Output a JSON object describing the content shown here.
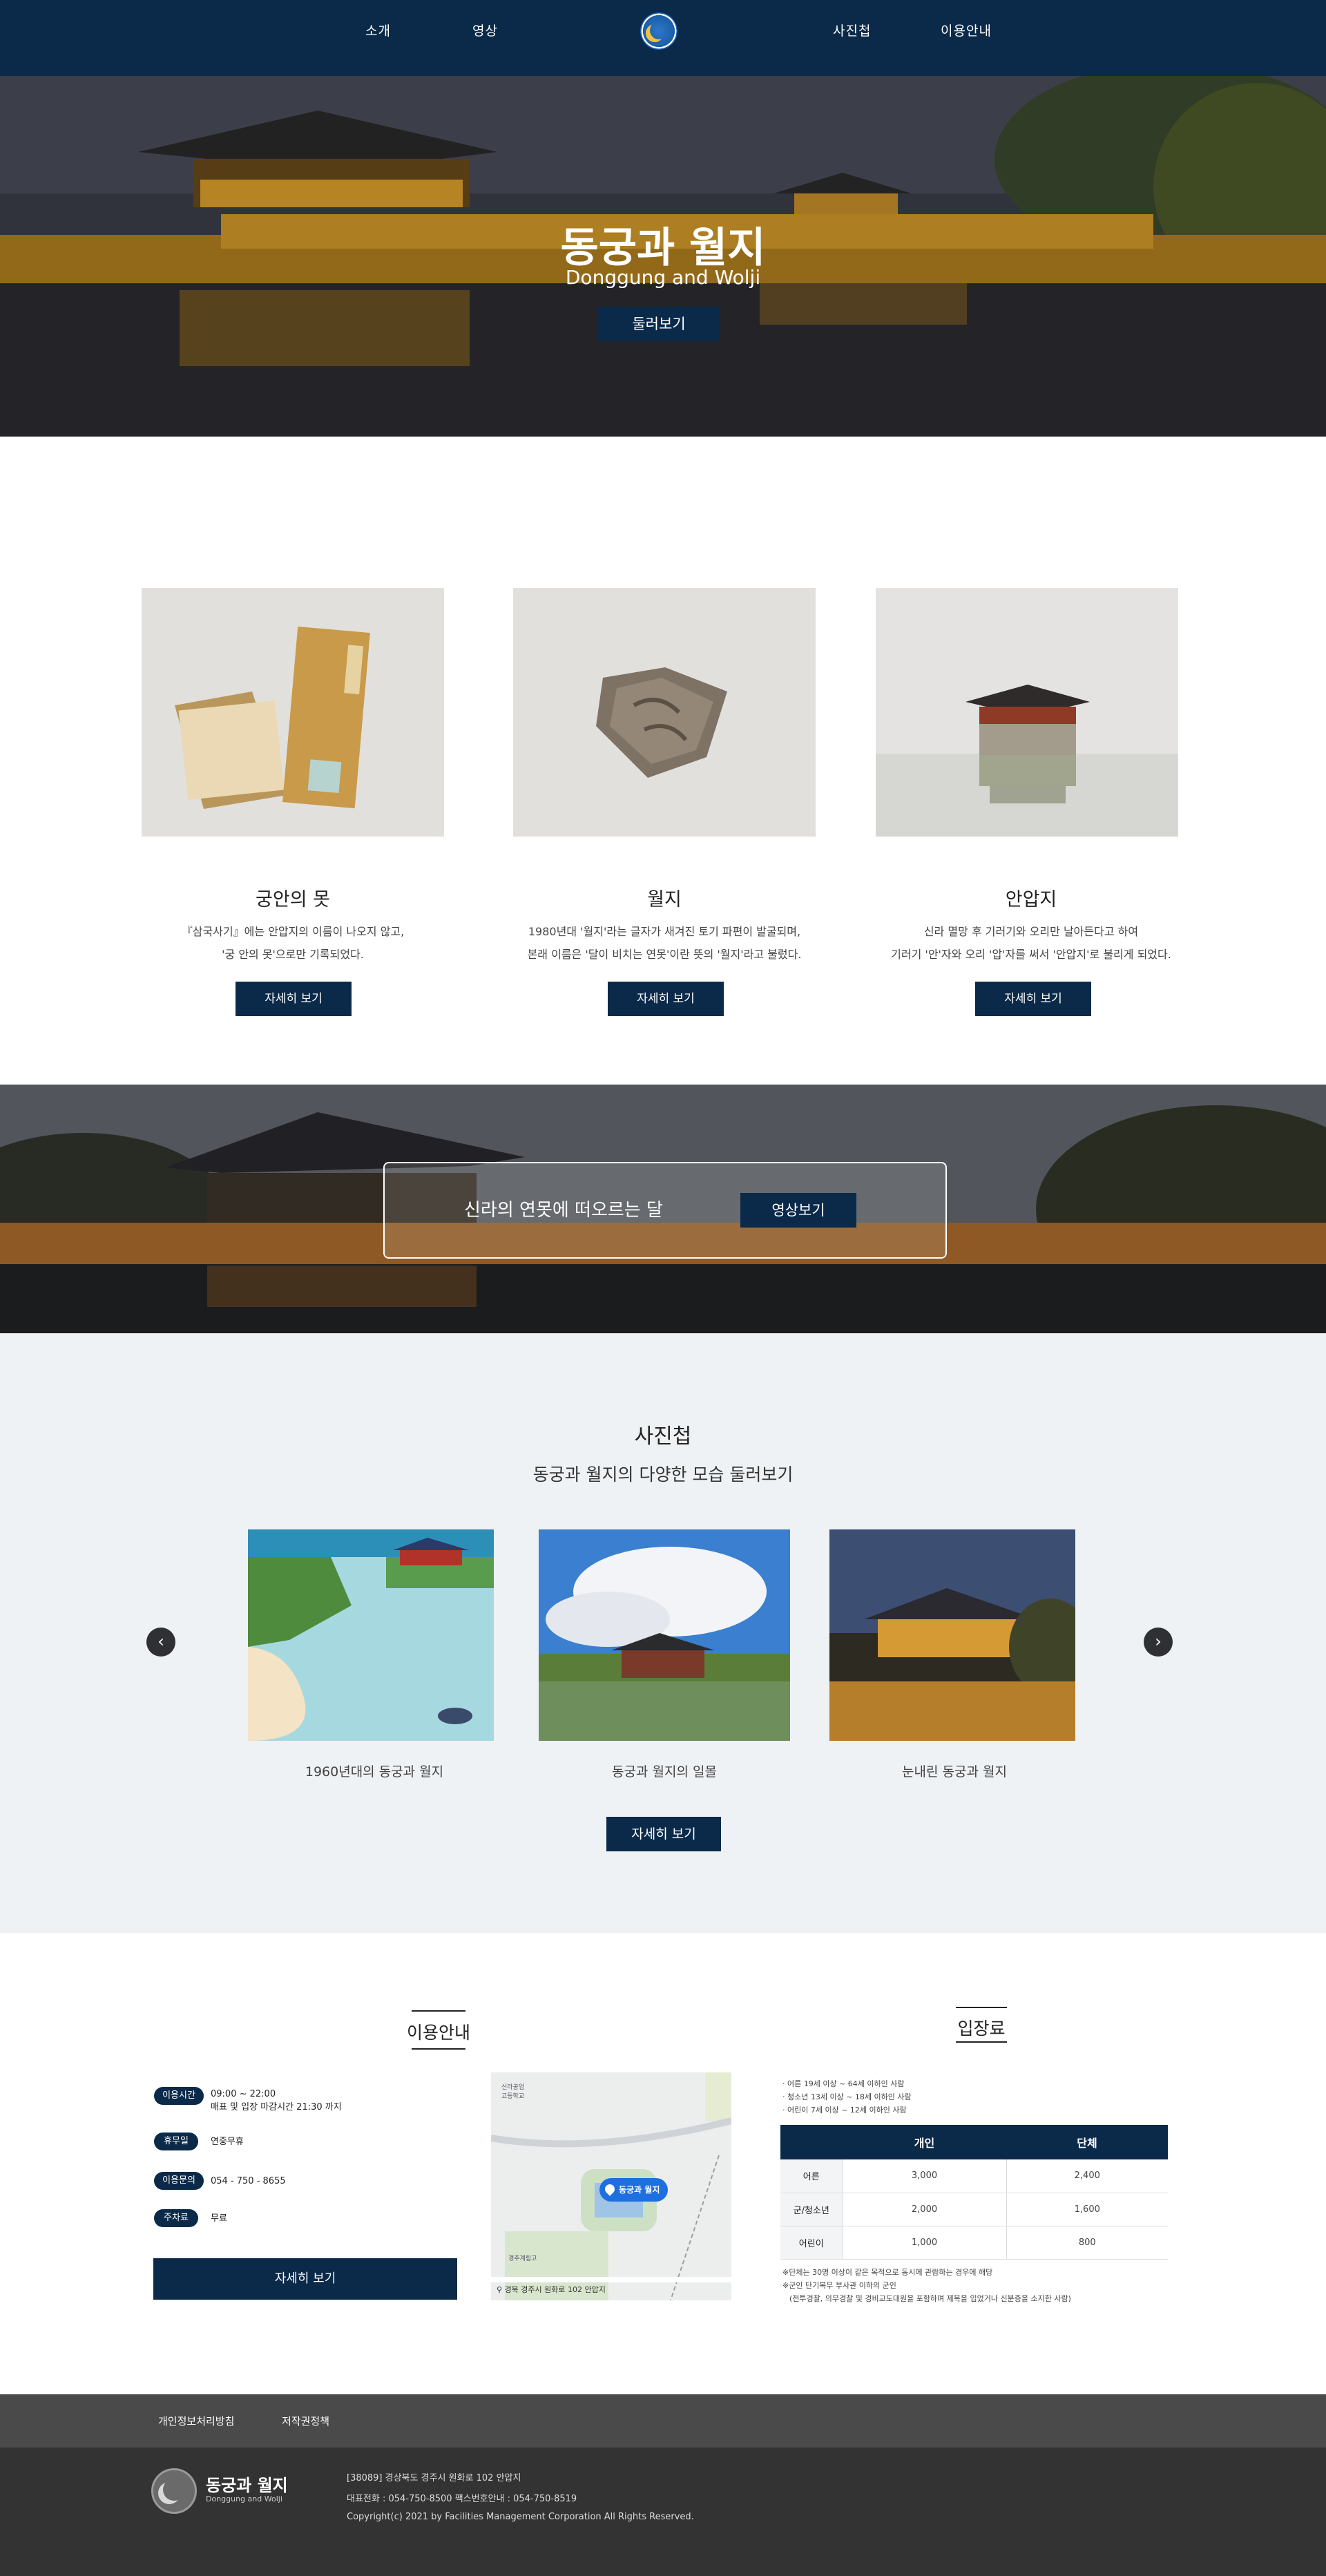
{
  "nav": {
    "left": [
      "소개",
      "영상"
    ],
    "right": [
      "사진첩",
      "이용안내"
    ]
  },
  "hero": {
    "title": "동궁과 월지",
    "subtitle": "Donggung and Wolji",
    "button": "둘러보기"
  },
  "cards": [
    {
      "title": "궁안의 못",
      "desc1": "『삼국사기』에는 안압지의 이름이 나오지 않고,",
      "desc2": "'궁 안의 못'으로만 기록되었다.",
      "button": "자세히 보기"
    },
    {
      "title": "월지",
      "desc1": "1980년대 '월지'라는 글자가 새겨진 토기 파편이 발굴되며,",
      "desc2": "본래 이름은 '달이 비치는 연못'이란 뜻의 '월지'라고 불렀다.",
      "button": "자세히 보기"
    },
    {
      "title": "안압지",
      "desc1": "신라 멸망 후 기러기와 오리만 날아든다고 하여",
      "desc2": "기러기 '안'자와 오리 '압'자를 써서 '안압지'로 불리게 되었다.",
      "button": "자세히 보기"
    }
  ],
  "video": {
    "text": "신라의 연못에 떠오르는 달",
    "button": "영상보기"
  },
  "gallery": {
    "title": "사진첩",
    "subtitle": "동궁과 월지의 다양한 모습 둘러보기",
    "captions": [
      "1960년대의 동궁과 월지",
      "동궁과 월지의 일몰",
      "눈내린 동궁과 월지"
    ],
    "button": "자세히 보기"
  },
  "info": {
    "title": "이용안내",
    "rows": [
      {
        "label": "이용시간",
        "value": "09:00 ~ 22:00",
        "value2": "매표 및 입장 마감시간 21:30 까지"
      },
      {
        "label": "휴무일",
        "value": "연중무휴"
      },
      {
        "label": "이용문의",
        "value": "054 - 750 - 8655"
      },
      {
        "label": "주차료",
        "value": "무료"
      }
    ],
    "button": "자세히 보기",
    "map_pin": "동궁과 월지",
    "map_address": "경북 경주시 원화로 102 안압지",
    "map_school1": "신라공업",
    "map_school2": "고등학교",
    "map_school3": "경주계림고"
  },
  "fee": {
    "title": "입장료",
    "notes": [
      "· 어른 19세 이상 ~ 64세 이하인 사람",
      "· 청소년 13세 이상 ~ 18세 이하인 사람",
      "· 어린이 7세 이상 ~ 12세 이하인 사람"
    ],
    "headers": [
      "",
      "개인",
      "단체"
    ],
    "rows": [
      [
        "어른",
        "3,000",
        "2,400"
      ],
      [
        "군/청소년",
        "2,000",
        "1,600"
      ],
      [
        "어린이",
        "1,000",
        "800"
      ]
    ],
    "foot1": "※단체는 30명 이상이 같은 목적으로 동시에 관람하는 경우에 해당",
    "foot2": "※군인 단기복무 부사관 이하의 군인",
    "foot3": "(전투경찰, 의무경찰 및 경비교도대원을 포함하며 제복을 입었거나 신분증을 소지한 사람)"
  },
  "footer": {
    "links": [
      "개인정보처리방침",
      "저작권정책"
    ],
    "brand": "동궁과 월지",
    "brand_sub": "Donggung and Wolji",
    "address": "[38089] 경상북도 경주시 원화로 102 안압지",
    "phone": "대표전화 : 054-750-8500 팩스번호안내 : 054-750-8519",
    "copyright": "Copyright(c) 2021 by Facilities Management Corporation All Rights Reserved."
  }
}
